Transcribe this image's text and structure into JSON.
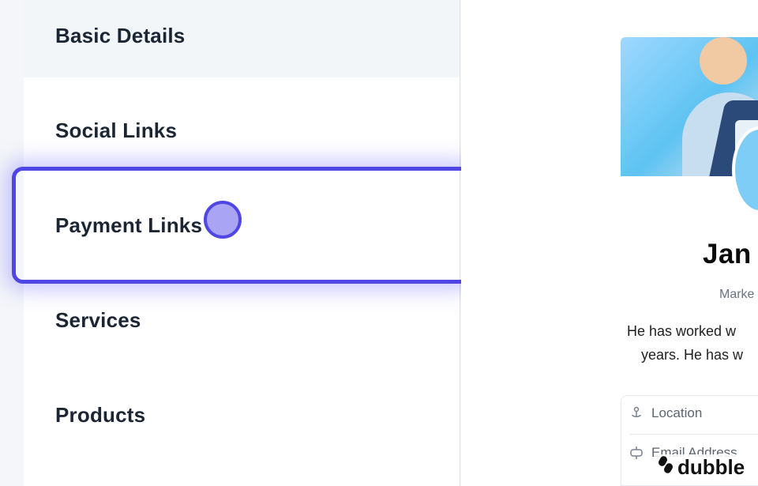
{
  "sidebar": {
    "items": [
      {
        "label": "Basic Details"
      },
      {
        "label": "Social Links"
      },
      {
        "label": "Payment Links"
      },
      {
        "label": "Services"
      },
      {
        "label": "Products"
      }
    ]
  },
  "preview": {
    "name": "Jan",
    "role": "Marke",
    "bio_line1": "He has worked w",
    "bio_line2": "years. He has w",
    "info": [
      {
        "label": "Location",
        "icon": "location-pin-icon"
      },
      {
        "label": "Email Address",
        "icon": "mailbox-icon"
      }
    ]
  },
  "brand": {
    "label": "dubble"
  },
  "colors": {
    "accent": "#4f46e5",
    "text": "#1b2533",
    "click_dot": "#8d86f0"
  }
}
